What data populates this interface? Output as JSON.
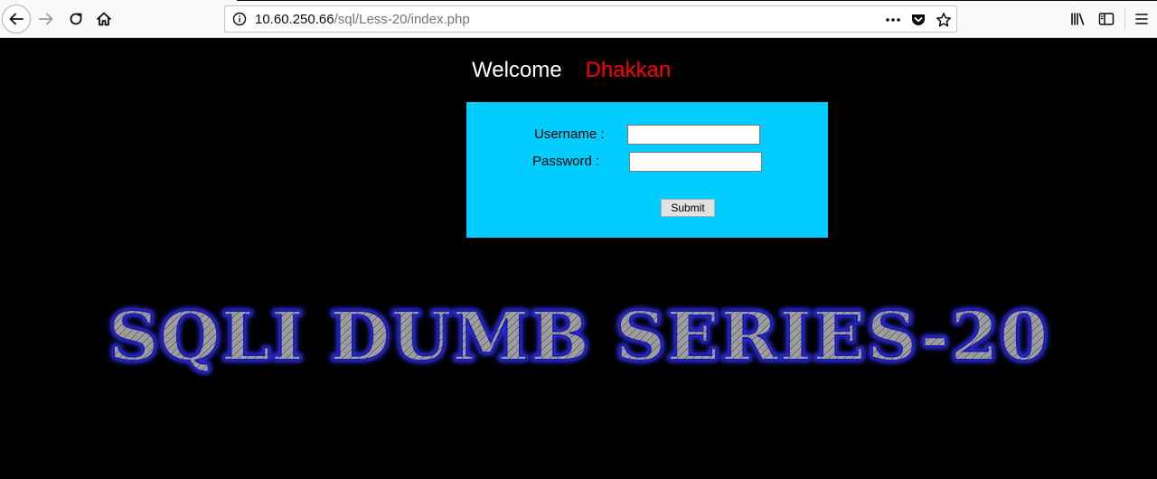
{
  "browser": {
    "url_host": "10.60.250.66",
    "url_path": "/sql/Less-20/index.php",
    "icons": {
      "back": "back-arrow-icon",
      "forward": "forward-arrow-icon",
      "reload": "reload-icon",
      "home": "home-icon",
      "info": "info-icon",
      "page_actions": "more-dots-icon",
      "pocket": "pocket-icon",
      "bookmark": "star-icon",
      "library": "library-icon",
      "sidebar": "sidebar-icon",
      "menu": "hamburger-menu-icon"
    }
  },
  "page": {
    "welcome_word": "Welcome",
    "welcome_name": "Dhakkan",
    "form": {
      "username_label": "Username :",
      "username_value": "",
      "password_label": "Password :",
      "password_value": "",
      "submit_label": "Submit"
    },
    "series_title": "SQLI DUMB SERIES-20"
  },
  "colors": {
    "page_background": "#000000",
    "form_background": "#00ccff",
    "welcome_name": "#ff0000",
    "welcome_word": "#ffffff",
    "title_glow": "#2a2ad8"
  }
}
